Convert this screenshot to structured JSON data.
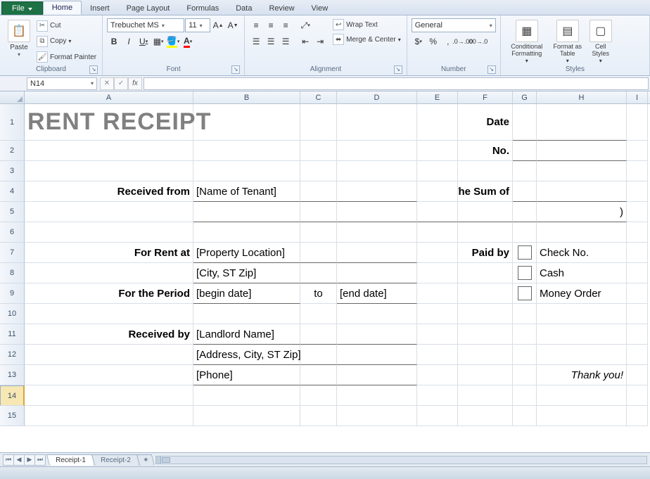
{
  "tabs": {
    "file": "File",
    "items": [
      "Home",
      "Insert",
      "Page Layout",
      "Formulas",
      "Data",
      "Review",
      "View"
    ],
    "active": "Home"
  },
  "ribbon": {
    "clipboard": {
      "label": "Clipboard",
      "paste": "Paste",
      "cut": "Cut",
      "copy": "Copy",
      "fp": "Format Painter"
    },
    "font": {
      "label": "Font",
      "name": "Trebuchet MS",
      "size": "11"
    },
    "alignment": {
      "label": "Alignment",
      "wrap": "Wrap Text",
      "merge": "Merge & Center"
    },
    "number": {
      "label": "Number",
      "format": "General"
    },
    "styles": {
      "label": "Styles",
      "cond": "Conditional Formatting",
      "tbl": "Format as Table",
      "cell": "Cell Styles"
    }
  },
  "namebox": "N14",
  "columns": [
    "A",
    "B",
    "C",
    "D",
    "E",
    "F",
    "G",
    "H",
    "I"
  ],
  "rows": [
    "1",
    "2",
    "3",
    "4",
    "5",
    "6",
    "7",
    "8",
    "9",
    "10",
    "11",
    "12",
    "13",
    "14",
    "15"
  ],
  "doc": {
    "title": "RENT RECEIPT",
    "date_lbl": "Date",
    "no_lbl": "No.",
    "recv_from_lbl": "Received from",
    "recv_from_val": "[Name of Tenant]",
    "sum_lbl": "The Sum of",
    "paren": ")",
    "rent_at_lbl": "For Rent at",
    "rent_at_val": "[Property Location]",
    "city_val": "[City, ST  Zip]",
    "period_lbl": "For the Period",
    "begin": "[begin date]",
    "to": "to",
    "end": "[end date]",
    "paidby_lbl": "Paid by",
    "check": "Check No.",
    "cash": "Cash",
    "money": "Money Order",
    "recv_by_lbl": "Received by",
    "landlord": "[Landlord Name]",
    "addr": "[Address, City, ST  Zip]",
    "phone": "[Phone]",
    "thanks": "Thank you!"
  },
  "sheets": {
    "s1": "Receipt-1",
    "s2": "Receipt-2"
  }
}
